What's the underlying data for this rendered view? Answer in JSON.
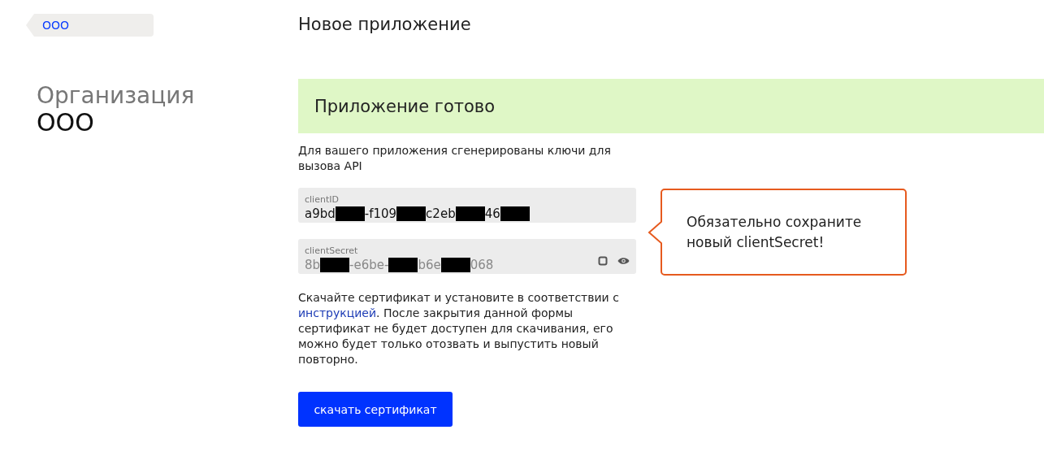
{
  "breadcrumb": {
    "label": "ООО"
  },
  "organization": {
    "caption": "Организация",
    "name": "ООО"
  },
  "page_title": "Новое приложение",
  "banner": {
    "title": "Приложение готово"
  },
  "intro": "Для вашего приложения сгенерированы ключи для вызова API",
  "fields": [
    {
      "label": "clientID",
      "secret": false,
      "value": [
        {
          "kind": "text",
          "text": "a9bd"
        },
        {
          "kind": "redacted"
        },
        {
          "kind": "text",
          "text": "-f109"
        },
        {
          "kind": "redacted"
        },
        {
          "kind": "text",
          "text": "c2eb"
        },
        {
          "kind": "redacted"
        },
        {
          "kind": "text",
          "text": "46"
        },
        {
          "kind": "redacted"
        }
      ]
    },
    {
      "label": "clientSecret",
      "secret": true,
      "value": [
        {
          "kind": "text",
          "text": "8b"
        },
        {
          "kind": "redacted"
        },
        {
          "kind": "text",
          "text": "-e6be-"
        },
        {
          "kind": "redacted"
        },
        {
          "kind": "text",
          "text": "b6e"
        },
        {
          "kind": "redacted"
        },
        {
          "kind": "text",
          "text": "068"
        }
      ]
    }
  ],
  "callout": {
    "text": "Обязательно сохраните новый clientSecret!"
  },
  "notice": {
    "before": "Скачайте сертификат и установите в соответствии с ",
    "link": "инструкцией",
    "after": ". После закрытия данной формы сертификат не будет доступен для скачивания, его можно будет только отозвать и выпустить новый повторно."
  },
  "download_button": "скачать сертификат"
}
